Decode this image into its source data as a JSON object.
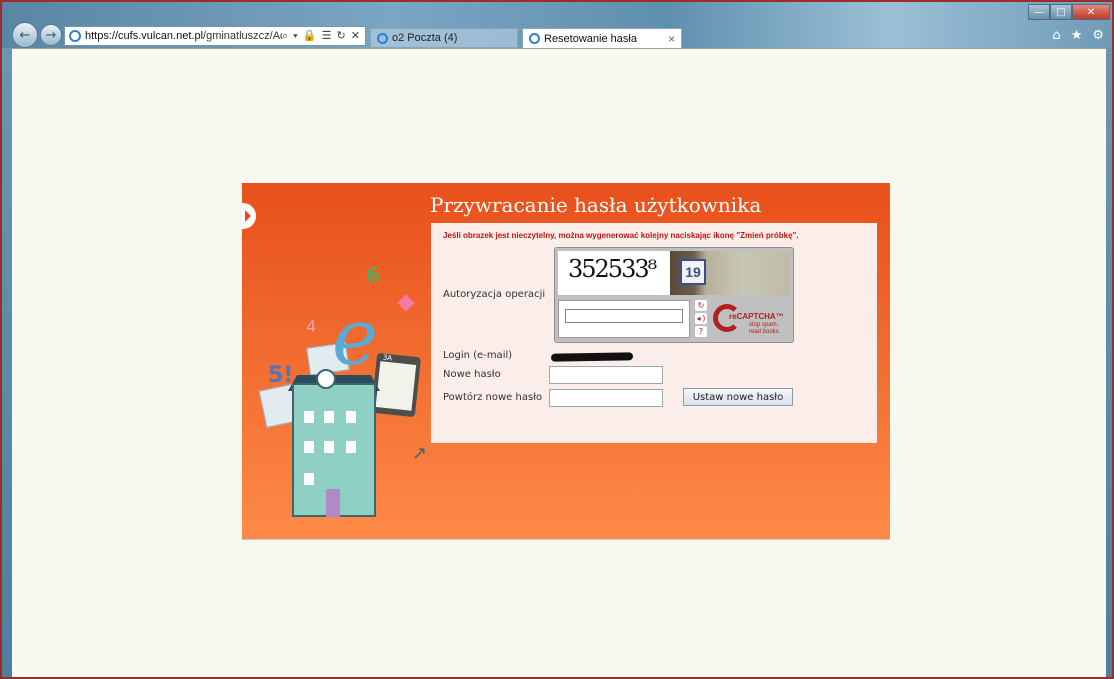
{
  "browser": {
    "url_host": "https://cufs.vulcan.net.pl",
    "url_path": "/gminatluszcz/Accoun",
    "address_tools": "⌕ ▾ 🔒 ☰ ↻ ✕",
    "tabs": [
      {
        "label": "o2 Poczta (4)"
      },
      {
        "label": "Resetowanie hasła",
        "close": "×"
      }
    ],
    "window_controls": {
      "minimize": "—",
      "maximize": "□",
      "close": "✕"
    },
    "right_icons": {
      "home": "⌂",
      "favorites": "★",
      "settings": "⚙"
    }
  },
  "page": {
    "title": "Przywracanie hasła użytkownika",
    "warning": "Jeśli obrazek jest nieczytelny, można wygenerować kolejny naciskając ikonę \"Zmień próbkę\".",
    "auth_label": "Autoryzacja operacji",
    "captcha": {
      "image_text": "352533⁸",
      "plate_number": "19",
      "brand": "reCAPTCHA™",
      "tagline": "stop spam.\nread books.",
      "icons": {
        "refresh": "↻",
        "audio": "◂ )",
        "help": "?"
      }
    },
    "login_label": "Login (e-mail)",
    "new_password_label": "Nowe hasło",
    "repeat_password_label": "Powtórz nowe hasło",
    "submit_label": "Ustaw nowe hasło",
    "illustration": {
      "e": "e",
      "six": "6",
      "five": "5!",
      "four": "4",
      "class": "3A",
      "arrow": "↗"
    }
  },
  "colors": {
    "panel_top": "#e8501c",
    "panel_bottom": "#ff8a48",
    "warning": "#c0140f",
    "recaptcha": "#b02020"
  }
}
